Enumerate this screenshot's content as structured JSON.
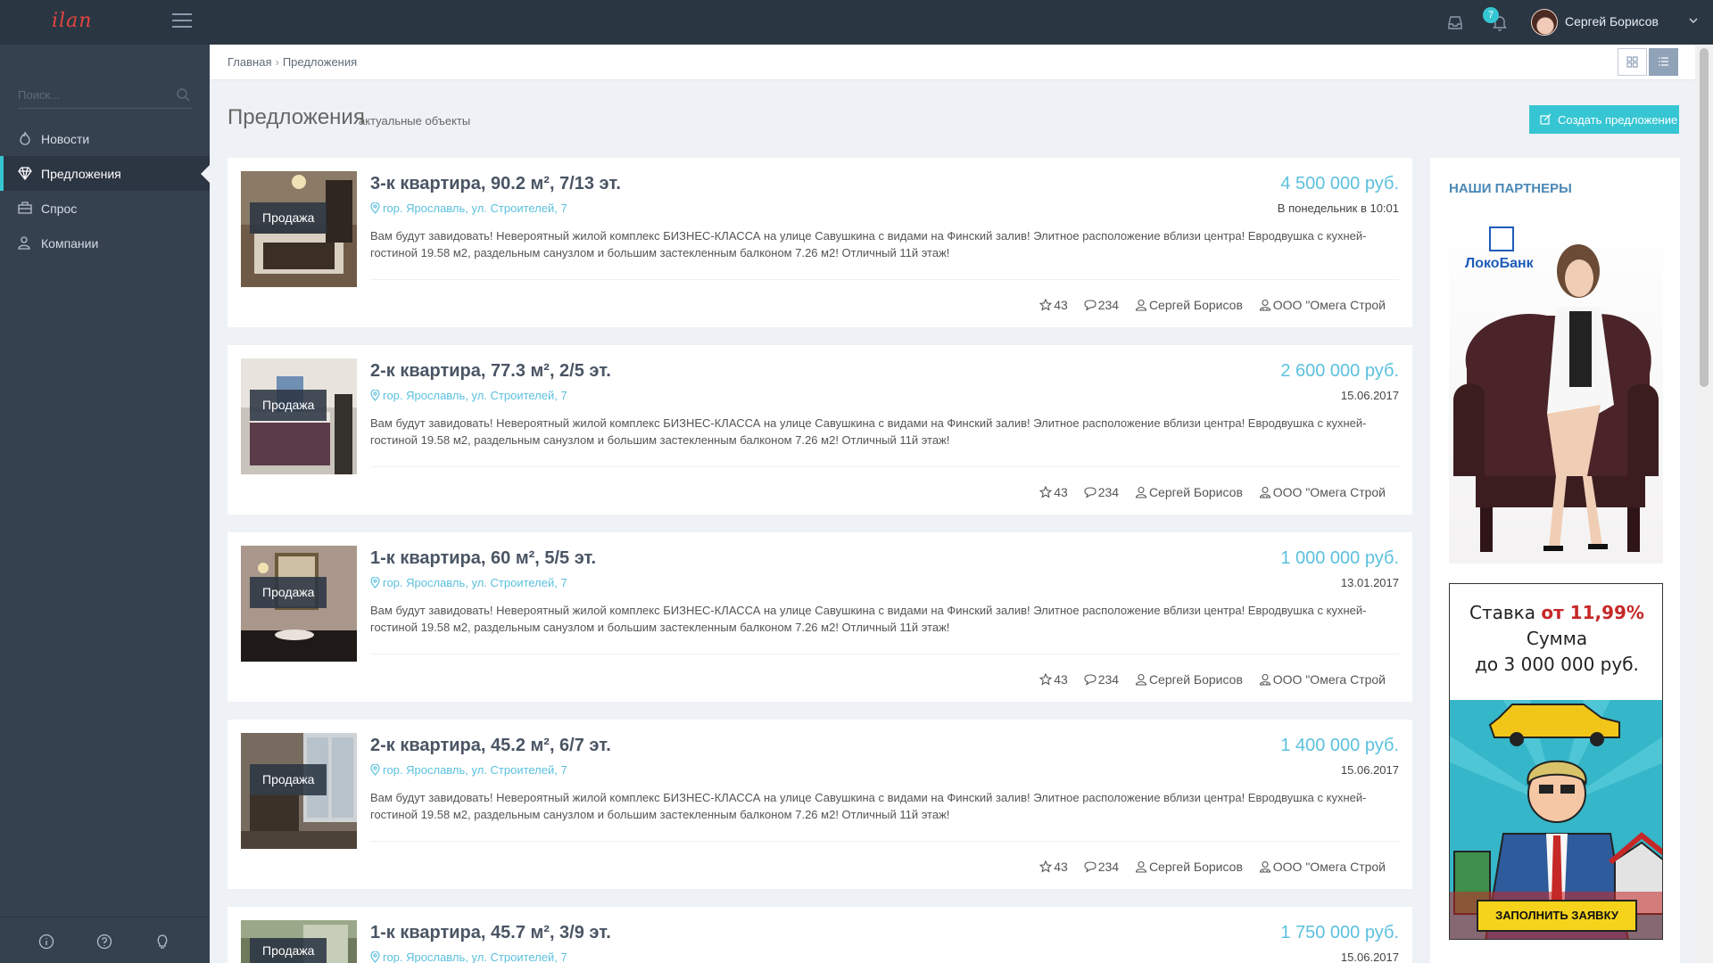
{
  "app": {
    "logo": "ilan"
  },
  "topbar": {
    "notifications_count": "7",
    "user_name": "Сергей Борисов"
  },
  "sidebar": {
    "search_placeholder": "Поиск...",
    "items": [
      {
        "label": "Новости",
        "icon": "fire-icon",
        "active": false
      },
      {
        "label": "Предложения",
        "icon": "diamond-icon",
        "active": true
      },
      {
        "label": "Спрос",
        "icon": "briefcase-icon",
        "active": false
      },
      {
        "label": "Компании",
        "icon": "users-icon",
        "active": false
      }
    ],
    "footer_icons": [
      "info-icon",
      "help-icon",
      "lightbulb-icon"
    ]
  },
  "breadcrumb": {
    "home": "Главная",
    "sep": "›",
    "current": "Предложения"
  },
  "page": {
    "title": "Предложения",
    "subtitle": "актуальные объекты",
    "create_button": "Создать предложение"
  },
  "listings": [
    {
      "tag": "Продажа",
      "title": "3-к квартира, 90.2 м², 7/13 эт.",
      "price": "4 500 000 руб.",
      "address": "гор. Ярославль, ул. Строителей, 7",
      "date": "В понедельник в 10:01",
      "description": "Вам будут завидовать! Невероятный жилой комплекс БИЗНЕС-КЛАССА на улице Савушкина с видами на Финский залив! Элитное расположение вблизи центра! Евродвушка с кухней-гостиной 19.58 м2, раздельным санузлом и большим застекленным балконом 7.26 м2! Отличный 11й этаж!",
      "favorites": "43",
      "comments": "234",
      "agent": "Сергей Борисов",
      "company": "ООО \"Омега Строй"
    },
    {
      "tag": "Продажа",
      "title": "2-к квартира, 77.3 м², 2/5 эт.",
      "price": "2 600 000 руб.",
      "address": "гор. Ярославль, ул. Строителей, 7",
      "date": "15.06.2017",
      "description": "Вам будут завидовать! Невероятный жилой комплекс БИЗНЕС-КЛАССА на улице Савушкина с видами на Финский залив! Элитное расположение вблизи центра! Евродвушка с кухней-гостиной 19.58 м2, раздельным санузлом и большим застекленным балконом 7.26 м2! Отличный 11й этаж!",
      "favorites": "43",
      "comments": "234",
      "agent": "Сергей Борисов",
      "company": "ООО \"Омега Строй"
    },
    {
      "tag": "Продажа",
      "title": "1-к квартира, 60 м², 5/5 эт.",
      "price": "1 000 000 руб.",
      "address": "гор. Ярославль, ул. Строителей, 7",
      "date": "13.01.2017",
      "description": "Вам будут завидовать! Невероятный жилой комплекс БИЗНЕС-КЛАССА на улице Савушкина с видами на Финский залив! Элитное расположение вблизи центра! Евродвушка с кухней-гостиной 19.58 м2, раздельным санузлом и большим застекленным балконом 7.26 м2! Отличный 11й этаж!",
      "favorites": "43",
      "comments": "234",
      "agent": "Сергей Борисов",
      "company": "ООО \"Омега Строй"
    },
    {
      "tag": "Продажа",
      "title": "2-к квартира, 45.2 м², 6/7 эт.",
      "price": "1 400 000 руб.",
      "address": "гор. Ярославль, ул. Строителей, 7",
      "date": "15.06.2017",
      "description": "Вам будут завидовать! Невероятный жилой комплекс БИЗНЕС-КЛАССА на улице Савушкина с видами на Финский залив! Элитное расположение вблизи центра! Евродвушка с кухней-гостиной 19.58 м2, раздельным санузлом и большим застекленным балконом 7.26 м2! Отличный 11й этаж!",
      "favorites": "43",
      "comments": "234",
      "agent": "Сергей Борисов",
      "company": "ООО \"Омега Строй"
    },
    {
      "tag": "Продажа",
      "title": "1-к квартира, 45.7 м², 3/9 эт.",
      "price": "1 750 000 руб.",
      "address": "гор. Ярославль, ул. Строителей, 7",
      "date": "15.06.2017",
      "description": "",
      "favorites": "",
      "comments": "",
      "agent": "",
      "company": ""
    }
  ],
  "partners": {
    "title": "НАШИ ПАРТНЕРЫ",
    "ad1_brand": "ЛокоБанк",
    "ad2_rate_prefix": "Ставка ",
    "ad2_rate_value": "от 11,99%",
    "ad2_line2": "Сумма",
    "ad2_line3": "до 3 000 000 руб.",
    "ad2_button": "ЗАПОЛНИТЬ ЗАЯВКУ"
  },
  "colors": {
    "accent": "#36c6d3",
    "price": "#5bc0de",
    "sidebar": "#364150",
    "topbar": "#2b3643"
  }
}
